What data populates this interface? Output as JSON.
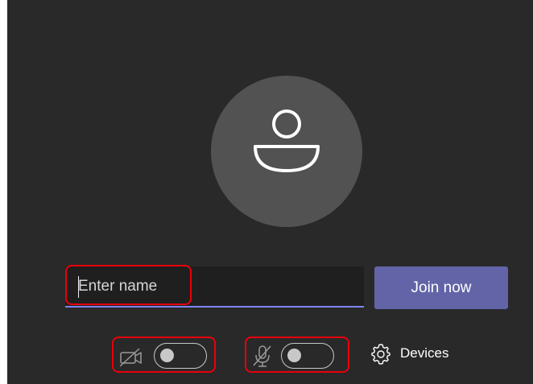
{
  "prejoin": {
    "name_input": {
      "placeholder": "Enter name",
      "value": ""
    },
    "join_button": {
      "label": "Join now"
    },
    "camera": {
      "icon": "camera-off-icon",
      "toggle_on": false
    },
    "microphone": {
      "icon": "microphone-off-icon",
      "toggle_on": false
    },
    "devices": {
      "icon": "gear-icon",
      "label": "Devices"
    },
    "avatar": {
      "icon": "person-icon"
    }
  },
  "colors": {
    "background": "#292929",
    "avatar": "#525252",
    "accent": "#6264a7",
    "input_underline": "#7f85f5",
    "highlight": "#e8000b"
  }
}
